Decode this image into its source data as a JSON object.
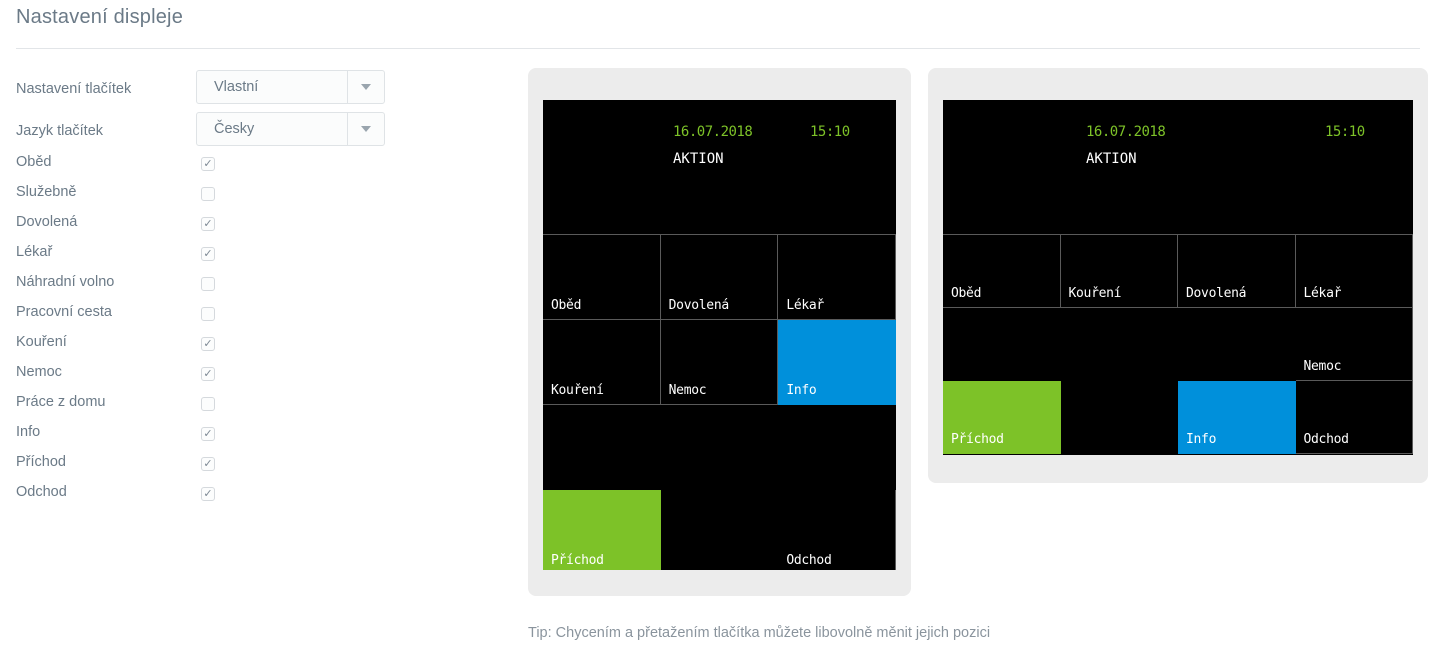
{
  "page": {
    "title": "Nastavení displeje",
    "tip": "Tip: Chycením a přetažením tlačítka můžete libovolně měnit jejich pozici"
  },
  "colors": {
    "accent_green": "#7dc228",
    "accent_blue": "#0090db",
    "screen_background": "#000000",
    "panel_background": "#ececec",
    "text_muted": "#6b7a87"
  },
  "form": {
    "selects": [
      {
        "label": "Nastavení tlačítek",
        "value": "Vlastní",
        "icon": "chevron-down-icon"
      },
      {
        "label": "Jazyk tlačítek",
        "value": "Česky",
        "icon": "chevron-down-icon"
      }
    ],
    "checkboxes": [
      {
        "label": "Oběd",
        "checked": true
      },
      {
        "label": "Služebně",
        "checked": false
      },
      {
        "label": "Dovolená",
        "checked": true
      },
      {
        "label": "Lékař",
        "checked": true
      },
      {
        "label": "Náhradní volno",
        "checked": false
      },
      {
        "label": "Pracovní cesta",
        "checked": false
      },
      {
        "label": "Kouření",
        "checked": true
      },
      {
        "label": "Nemoc",
        "checked": true
      },
      {
        "label": "Práce z domu",
        "checked": false
      },
      {
        "label": "Info",
        "checked": true
      },
      {
        "label": "Příchod",
        "checked": true
      },
      {
        "label": "Odchod",
        "checked": true
      }
    ]
  },
  "previews": [
    {
      "id": "device-preview-3col",
      "columns": 3,
      "header": {
        "date": "16.07.2018",
        "time": "15:10",
        "brand": "AKTION"
      },
      "tiles": [
        {
          "label": "Oběd",
          "style": "default"
        },
        {
          "label": "Dovolená",
          "style": "default"
        },
        {
          "label": "Lékař",
          "style": "default"
        },
        {
          "label": "Kouření",
          "style": "default"
        },
        {
          "label": "Nemoc",
          "style": "default"
        },
        {
          "label": "Info",
          "style": "accent-blue"
        },
        {
          "label": "",
          "style": "empty"
        },
        {
          "label": "",
          "style": "empty"
        },
        {
          "label": "",
          "style": "empty"
        },
        {
          "label": "Příchod",
          "style": "accent-green"
        },
        {
          "label": "",
          "style": "empty"
        },
        {
          "label": "Odchod",
          "style": "default"
        }
      ]
    },
    {
      "id": "device-preview-4col",
      "columns": 4,
      "header": {
        "date": "16.07.2018",
        "time": "15:10",
        "brand": "AKTION"
      },
      "tiles": [
        {
          "label": "Oběd",
          "style": "default"
        },
        {
          "label": "Kouření",
          "style": "default"
        },
        {
          "label": "Dovolená",
          "style": "default"
        },
        {
          "label": "Lékař",
          "style": "default"
        },
        {
          "label": "",
          "style": "empty"
        },
        {
          "label": "",
          "style": "empty"
        },
        {
          "label": "",
          "style": "empty"
        },
        {
          "label": "Nemoc",
          "style": "default"
        },
        {
          "label": "Příchod",
          "style": "accent-green"
        },
        {
          "label": "",
          "style": "empty"
        },
        {
          "label": "Info",
          "style": "accent-blue"
        },
        {
          "label": "Odchod",
          "style": "default"
        }
      ]
    }
  ]
}
